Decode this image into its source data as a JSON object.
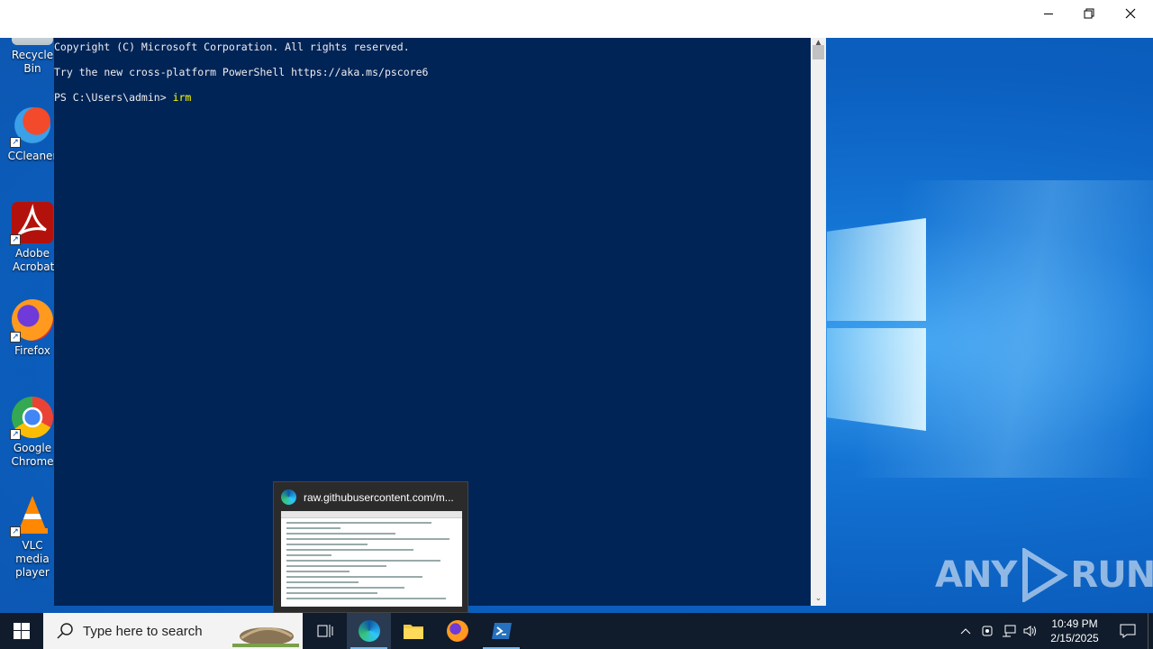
{
  "desktop_icons": [
    {
      "label": "Recycle Bin",
      "icon": "recycle-bin-icon"
    },
    {
      "label": "CCleaner",
      "icon": "ccleaner-icon"
    },
    {
      "label": "Adobe Acrobat",
      "icon": "adobe-acrobat-icon"
    },
    {
      "label": "Firefox",
      "icon": "firefox-icon"
    },
    {
      "label": "Google Chrome",
      "icon": "chrome-icon"
    },
    {
      "label": "VLC media player",
      "icon": "vlc-icon"
    }
  ],
  "window": {
    "controls": {
      "minimize": "—",
      "restore": "❐",
      "close": "✕"
    }
  },
  "console": {
    "lines": [
      "Copyright (C) Microsoft Corporation. All rights reserved.",
      "Try the new cross-platform PowerShell https://aka.ms/pscore6"
    ],
    "prompt": "PS C:\\Users\\admin> ",
    "command": "irm",
    "background": "#012456",
    "command_color": "#ffff00"
  },
  "preview": {
    "title": "raw.githubusercontent.com/m..."
  },
  "watermark": {
    "left": "ANY",
    "right": "RUN"
  },
  "taskbar": {
    "search_placeholder": "Type here to search",
    "apps": [
      "task-view-icon",
      "edge-icon",
      "file-explorer-icon",
      "firefox-icon",
      "powershell-icon"
    ],
    "clock": {
      "time": "10:49 PM",
      "date": "2/15/2025"
    }
  }
}
